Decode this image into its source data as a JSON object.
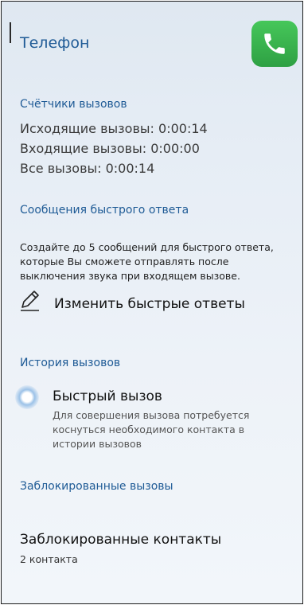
{
  "header": {
    "title": "Телефон",
    "icon": "phone-icon"
  },
  "call_counters": {
    "heading": "Счётчики вызовов",
    "outgoing": "Исходящие вызовы: 0:00:14",
    "incoming": "Входящие вызовы: 0:00:00",
    "all": "Все вызовы: 0:00:14"
  },
  "quick_replies": {
    "heading": "Сообщения быстрого ответа",
    "description": "Создайте до 5 сообщений для быстрого ответа, которые Вы сможете отправлять после выключения звука при входящем вызове.",
    "edit_label": "Изменить быстрые ответы",
    "edit_icon": "pencil-icon"
  },
  "call_history": {
    "heading": "История вызовов",
    "quick_call_title": "Быстрый вызов",
    "quick_call_desc": "Для совершения вызова потребуется коснуться необходимого контакта в истории вызовов",
    "quick_call_toggle": "toggle-indicator"
  },
  "blocked_calls": {
    "heading": "Заблокированные вызовы",
    "blocked_contacts_title": "Заблокированные контакты",
    "blocked_contacts_count": "2 контакта"
  },
  "colors": {
    "accent": "#1f5b96",
    "icon_green": "#3bb54a",
    "background": "#e6edf5"
  }
}
